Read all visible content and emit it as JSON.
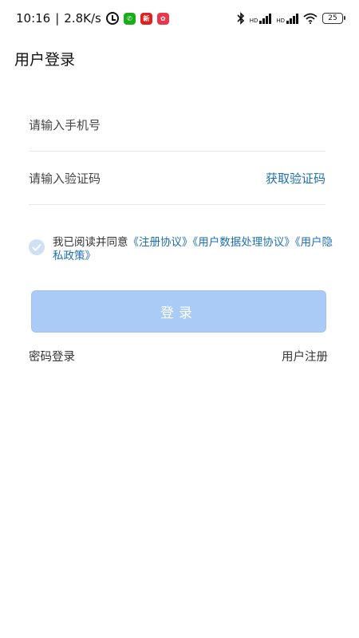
{
  "status_bar": {
    "time": "10:16",
    "separator": "|",
    "speed": "2.8K/s",
    "battery": "25",
    "hd1": "HD",
    "hd2": "HD",
    "app_badges": [
      {
        "name": "wechat",
        "color": "#1aad19",
        "glyph": "✆"
      },
      {
        "name": "sina-news",
        "color": "#e02020",
        "glyph": "新"
      },
      {
        "name": "red-app",
        "color": "#e8364a",
        "glyph": "✿"
      }
    ]
  },
  "header": {
    "title": "用户登录"
  },
  "form": {
    "phone_placeholder": "请输入手机号",
    "code_placeholder": "请输入验证码",
    "get_code_label": "获取验证码"
  },
  "agreement": {
    "prefix": "我已阅读并同意",
    "link1": "《注册协议》",
    "link2": "《用户数据处理协议》",
    "link3": "《用户隐私政策》"
  },
  "actions": {
    "login_label": "登录",
    "password_login": "密码登录",
    "register": "用户注册"
  },
  "colors": {
    "accent": "#1f6fb2",
    "button_bg": "#a9cbf5",
    "check_bg": "#cfe0f5"
  }
}
